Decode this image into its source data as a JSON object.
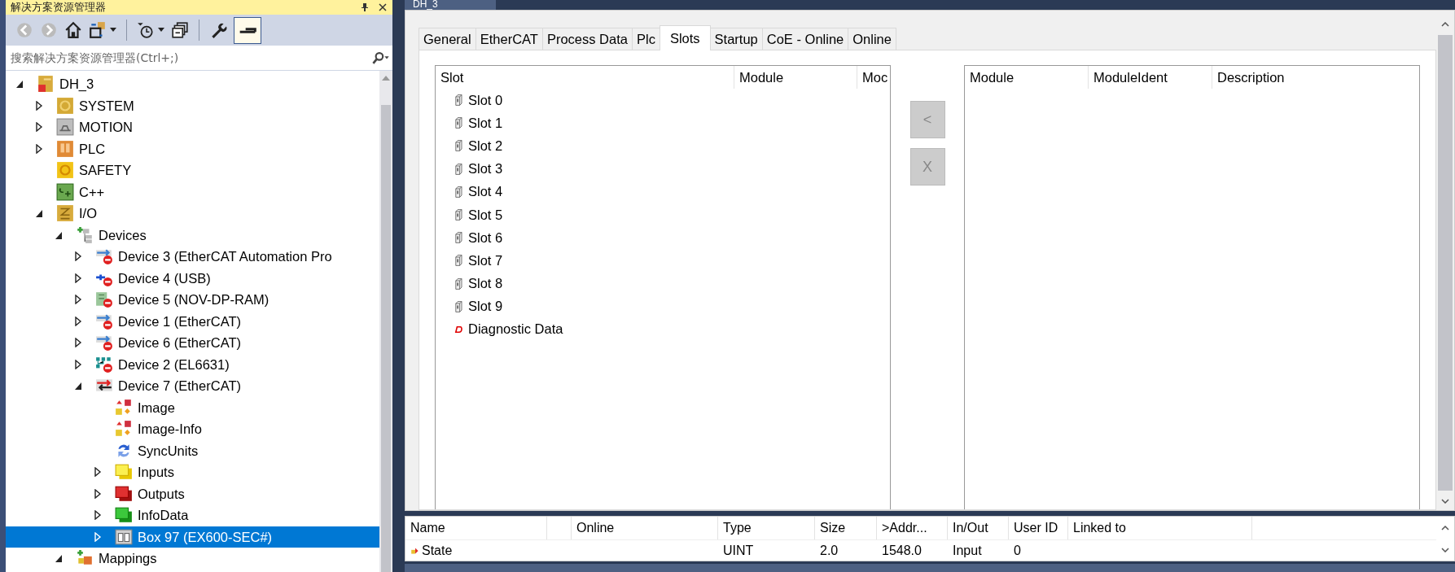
{
  "explorer": {
    "title": "解决方案资源管理器",
    "search": {
      "placeholder": "搜索解决方案资源管理器(Ctrl+;)"
    },
    "tree": [
      {
        "label": "DH_3",
        "kind": "project",
        "expanded": true,
        "selected": false,
        "children": [
          {
            "label": "SYSTEM",
            "kind": "system",
            "expanded": false,
            "selected": false
          },
          {
            "label": "MOTION",
            "kind": "motion",
            "expanded": false,
            "selected": false
          },
          {
            "label": "PLC",
            "kind": "plc",
            "expanded": false,
            "selected": false
          },
          {
            "label": "SAFETY",
            "kind": "safety",
            "selected": false
          },
          {
            "label": "C++",
            "kind": "cpp",
            "selected": false
          },
          {
            "label": "I/O",
            "kind": "io",
            "expanded": true,
            "selected": false,
            "children": [
              {
                "label": "Devices",
                "kind": "devices",
                "expanded": true,
                "selected": false,
                "children": [
                  {
                    "label": "Device 3 (EtherCAT Automation Pro",
                    "kind": "device-off",
                    "expanded": false,
                    "selected": false
                  },
                  {
                    "label": "Device 4 (USB)",
                    "kind": "usb-off",
                    "expanded": false,
                    "selected": false
                  },
                  {
                    "label": "Device 5 (NOV-DP-RAM)",
                    "kind": "board-off",
                    "expanded": false,
                    "selected": false
                  },
                  {
                    "label": "Device 1 (EtherCAT)",
                    "kind": "device-off",
                    "expanded": false,
                    "selected": false
                  },
                  {
                    "label": "Device 6 (EtherCAT)",
                    "kind": "device-off",
                    "expanded": false,
                    "selected": false
                  },
                  {
                    "label": "Device 2 (EL6631)",
                    "kind": "net-off",
                    "expanded": false,
                    "selected": false
                  },
                  {
                    "label": "Device 7 (EtherCAT)",
                    "kind": "device",
                    "expanded": true,
                    "selected": false,
                    "children": [
                      {
                        "label": "Image",
                        "kind": "image",
                        "selected": false
                      },
                      {
                        "label": "Image-Info",
                        "kind": "image",
                        "selected": false
                      },
                      {
                        "label": "SyncUnits",
                        "kind": "sync",
                        "selected": false
                      },
                      {
                        "label": "Inputs",
                        "kind": "inputs",
                        "expanded": false,
                        "selected": false
                      },
                      {
                        "label": "Outputs",
                        "kind": "outputs",
                        "expanded": false,
                        "selected": false
                      },
                      {
                        "label": "InfoData",
                        "kind": "info",
                        "expanded": false,
                        "selected": false
                      },
                      {
                        "label": "Box 97 (EX600-SEC#)",
                        "kind": "box",
                        "expanded": false,
                        "selected": true
                      }
                    ]
                  }
                ]
              },
              {
                "label": "Mappings",
                "kind": "mappings",
                "expanded": true,
                "selected": false
              }
            ]
          }
        ]
      }
    ]
  },
  "document": {
    "tab": "DH_3",
    "tabs": [
      {
        "label": "General",
        "selected": false
      },
      {
        "label": "EtherCAT",
        "selected": false
      },
      {
        "label": "Process Data",
        "selected": false
      },
      {
        "label": "Plc",
        "selected": false
      },
      {
        "label": "Slots",
        "selected": true
      },
      {
        "label": "Startup",
        "selected": false
      },
      {
        "label": "CoE - Online",
        "selected": false
      },
      {
        "label": "Online",
        "selected": false
      }
    ],
    "slot_list": {
      "columns": [
        "Slot",
        "Module",
        "Moc"
      ],
      "rows": [
        {
          "label": "Slot 0",
          "kind": "slot"
        },
        {
          "label": "Slot 1",
          "kind": "slot"
        },
        {
          "label": "Slot 2",
          "kind": "slot"
        },
        {
          "label": "Slot 3",
          "kind": "slot"
        },
        {
          "label": "Slot 4",
          "kind": "slot"
        },
        {
          "label": "Slot 5",
          "kind": "slot"
        },
        {
          "label": "Slot 6",
          "kind": "slot"
        },
        {
          "label": "Slot 7",
          "kind": "slot"
        },
        {
          "label": "Slot 8",
          "kind": "slot"
        },
        {
          "label": "Slot 9",
          "kind": "slot"
        },
        {
          "label": "Diagnostic Data",
          "kind": "diag"
        }
      ]
    },
    "buttons": [
      {
        "label": "<",
        "disabled": true
      },
      {
        "label": "X",
        "disabled": true
      }
    ],
    "module_list": {
      "columns": [
        "Module",
        "ModuleIdent",
        "Description"
      ]
    }
  },
  "variables": {
    "columns": [
      "Name",
      "Online",
      "Type",
      "Size",
      ">Addr...",
      "In/Out",
      "User ID",
      "Linked to"
    ],
    "rows": [
      {
        "cells": [
          "State",
          "",
          "UINT",
          "2.0",
          "1548.0",
          "Input",
          "0",
          ""
        ]
      }
    ]
  }
}
